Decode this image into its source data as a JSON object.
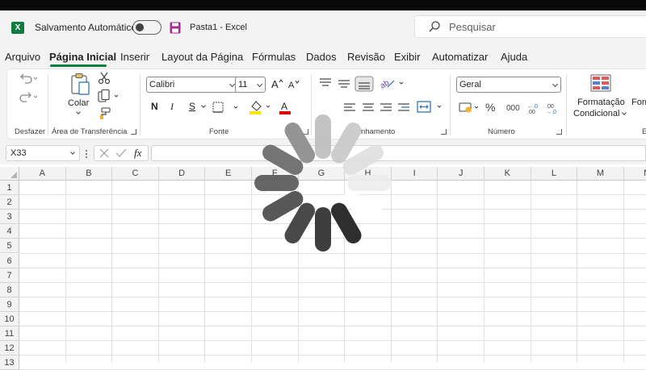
{
  "titlebar": {
    "app_icon": "excel-logo-icon",
    "app_icon_letter": "X",
    "autosave_label": "Salvamento Automático",
    "autosave_on": false,
    "document_title": "Pasta1  -  Excel",
    "search_placeholder": "Pesquisar"
  },
  "menu": {
    "items": [
      "Arquivo",
      "Página Inicial",
      "Inserir",
      "Layout da Página",
      "Fórmulas",
      "Dados",
      "Revisão",
      "Exibir",
      "Automatizar",
      "Ajuda"
    ],
    "active": "Página Inicial",
    "accent_color": "#107c41"
  },
  "ribbon": {
    "undo_group_label": "Desfazer",
    "clipboard": {
      "paste_label": "Colar",
      "group_label": "Área de Transferência"
    },
    "font": {
      "font_name": "Calibri",
      "font_size": "11",
      "bold_label": "N",
      "italic_label": "I",
      "underline_label": "S",
      "group_label": "Fonte"
    },
    "alignment": {
      "group_label_partial": "nhamento"
    },
    "number": {
      "format": "Geral",
      "group_label": "Número"
    },
    "styles": {
      "conditional_label_1": "Formatação",
      "conditional_label_2": "Condicional",
      "format_table_partial": "Form",
      "styles_partial": "Es"
    }
  },
  "formula_bar": {
    "name_box": "X33",
    "fx_label": "fx",
    "formula_value": ""
  },
  "sheet": {
    "columns": [
      "A",
      "B",
      "C",
      "D",
      "E",
      "F",
      "G",
      "H",
      "I",
      "J",
      "K",
      "L",
      "M",
      "N"
    ],
    "rows": [
      "1",
      "2",
      "3",
      "4",
      "5",
      "6",
      "7",
      "8",
      "9",
      "10",
      "11",
      "12",
      "13"
    ]
  },
  "overlay": {
    "loading_spinner": "loading-spinner-icon"
  }
}
